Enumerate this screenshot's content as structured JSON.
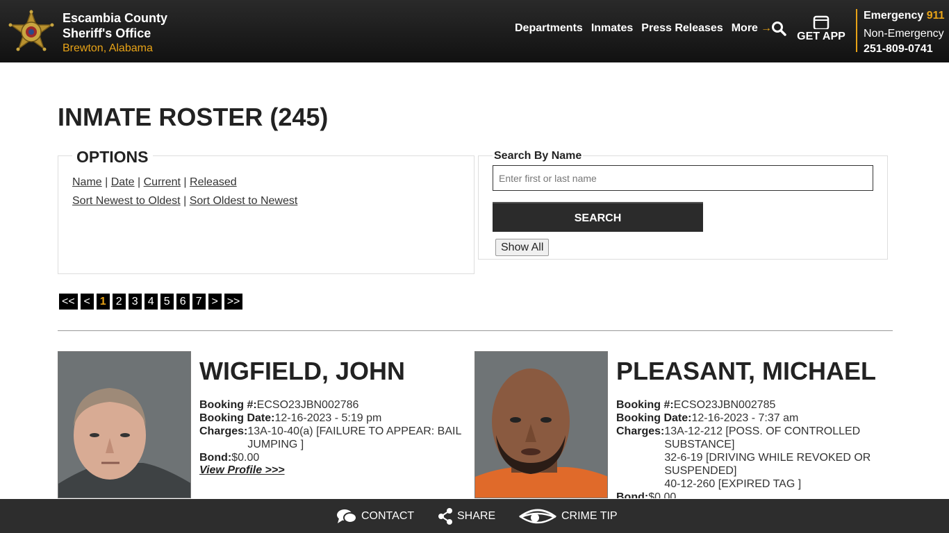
{
  "header": {
    "org_line1": "Escambia County",
    "org_line2": "Sheriff's Office",
    "org_line3": "Brewton, Alabama",
    "nav": [
      "Departments",
      "Inmates",
      "Press Releases",
      "More"
    ],
    "get_app": "GET APP",
    "emergency_label": "Emergency",
    "emergency_number": "911",
    "non_emergency_label": "Non-Emergency",
    "non_emergency_number": "251-809-0741",
    "accent_color": "#e8a317"
  },
  "title": "INMATE ROSTER (245)",
  "options": {
    "heading": "OPTIONS",
    "sort_links": [
      "Name",
      "Date",
      "Current",
      "Released"
    ],
    "order_links": [
      "Sort Newest to Oldest",
      "Sort Oldest to Newest"
    ],
    "separator": "|"
  },
  "search": {
    "label": "Search By Name",
    "placeholder": "Enter first or last name",
    "button": "SEARCH",
    "show_all": "Show All"
  },
  "pagination": [
    "<<",
    "<",
    "1",
    "2",
    "3",
    "4",
    "5",
    "6",
    "7",
    ">",
    ">>"
  ],
  "pagination_current": "1",
  "inmates": [
    {
      "name": "WIGFIELD, JOHN",
      "booking_no_label": "Booking #:",
      "booking_no": "ECSO23JBN002786",
      "booking_date_label": "Booking Date:",
      "booking_date": "12-16-2023 - 5:19 pm",
      "charges_label": "Charges:",
      "charges": [
        "13A-10-40(a) [FAILURE TO APPEAR: BAIL JUMPING ]"
      ],
      "bond_label": "Bond:",
      "bond": "$0.00",
      "view_profile": "View Profile >>>"
    },
    {
      "name": "PLEASANT, MICHAEL",
      "booking_no_label": "Booking #:",
      "booking_no": "ECSO23JBN002785",
      "booking_date_label": "Booking Date:",
      "booking_date": "12-16-2023 - 7:37 am",
      "charges_label": "Charges:",
      "charges": [
        "13A-12-212 [POSS. OF CONTROLLED SUBSTANCE]",
        "32-6-19 [DRIVING WHILE REVOKED OR SUSPENDED]",
        "40-12-260 [EXPIRED TAG ]"
      ],
      "bond_label": "Bond:",
      "bond": "$0.00"
    }
  ],
  "footer": {
    "contact": "CONTACT",
    "share": "SHARE",
    "crime_tip": "CRIME TIP"
  }
}
